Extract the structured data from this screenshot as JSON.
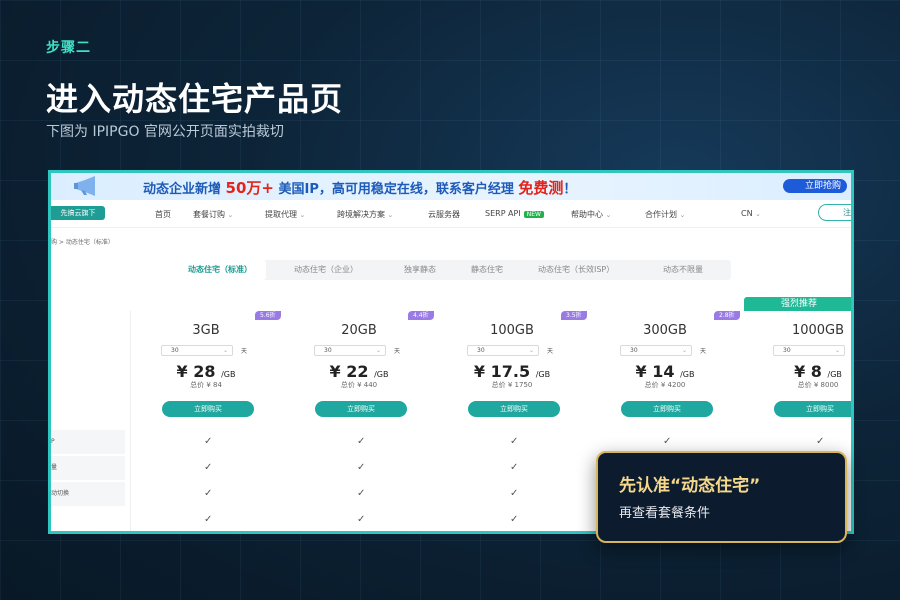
{
  "header": {
    "step": "步骤二",
    "title": "进入动态住宅产品页",
    "subtitle": "下图为 IPIPGO 官网公开页面实拍裁切"
  },
  "banner": {
    "text_a": "动态企业新增 ",
    "text_highlight": "50万+",
    "text_b": " 美国IP，高可用稳定在线，联系客户经理 ",
    "text_free": "免费测",
    "text_c": "！",
    "button": "立即抢购"
  },
  "nav": {
    "logo_chip": "先搞云旗下",
    "items": [
      "首页",
      "套餐订购",
      "提取代理",
      "跨境解决方案",
      "云服务器",
      "SERP API",
      "帮助中心",
      "合作计划"
    ],
    "new_badge": "NEW",
    "lang": "CN",
    "register": "注册"
  },
  "breadcrumb": "购 > 动态住宅（标准）",
  "tabs": [
    "动态住宅（标准）",
    "动态住宅（企业）",
    "独享静态",
    "静态住宅",
    "动态住宅（长效ISP）",
    "动态不限量"
  ],
  "recommend": "强烈推荐",
  "day_unit": "天",
  "plans": [
    {
      "discount": "5.6折",
      "size": "3GB",
      "days": "30",
      "price": "¥ 28",
      "unit": "/GB",
      "total": "总价 ¥ 84",
      "buy": "立即购买"
    },
    {
      "discount": "4.4折",
      "size": "20GB",
      "days": "30",
      "price": "¥ 22",
      "unit": "/GB",
      "total": "总价 ¥ 440",
      "buy": "立即购买"
    },
    {
      "discount": "3.5折",
      "size": "100GB",
      "days": "30",
      "price": "¥ 17.5",
      "unit": "/GB",
      "total": "总价 ¥ 1750",
      "buy": "立即购买"
    },
    {
      "discount": "2.8折",
      "size": "300GB",
      "days": "30",
      "price": "¥ 14",
      "unit": "/GB",
      "total": "总价 ¥ 4200",
      "buy": "立即购买"
    },
    {
      "discount": "",
      "size": "1000GB",
      "days": "30",
      "price": "¥ 8",
      "unit": "/GB",
      "total": "总价 ¥ 8000",
      "buy": "立即购买"
    }
  ],
  "feature_rows": [
    {
      "label": "P",
      "check": "✓"
    },
    {
      "label": "量",
      "check": "✓"
    },
    {
      "label": "动切换",
      "check": "✓"
    },
    {
      "label": "",
      "check": "✓"
    }
  ],
  "callout": {
    "title": "先认准“动态住宅”",
    "subtitle": "再查看套餐条件"
  }
}
